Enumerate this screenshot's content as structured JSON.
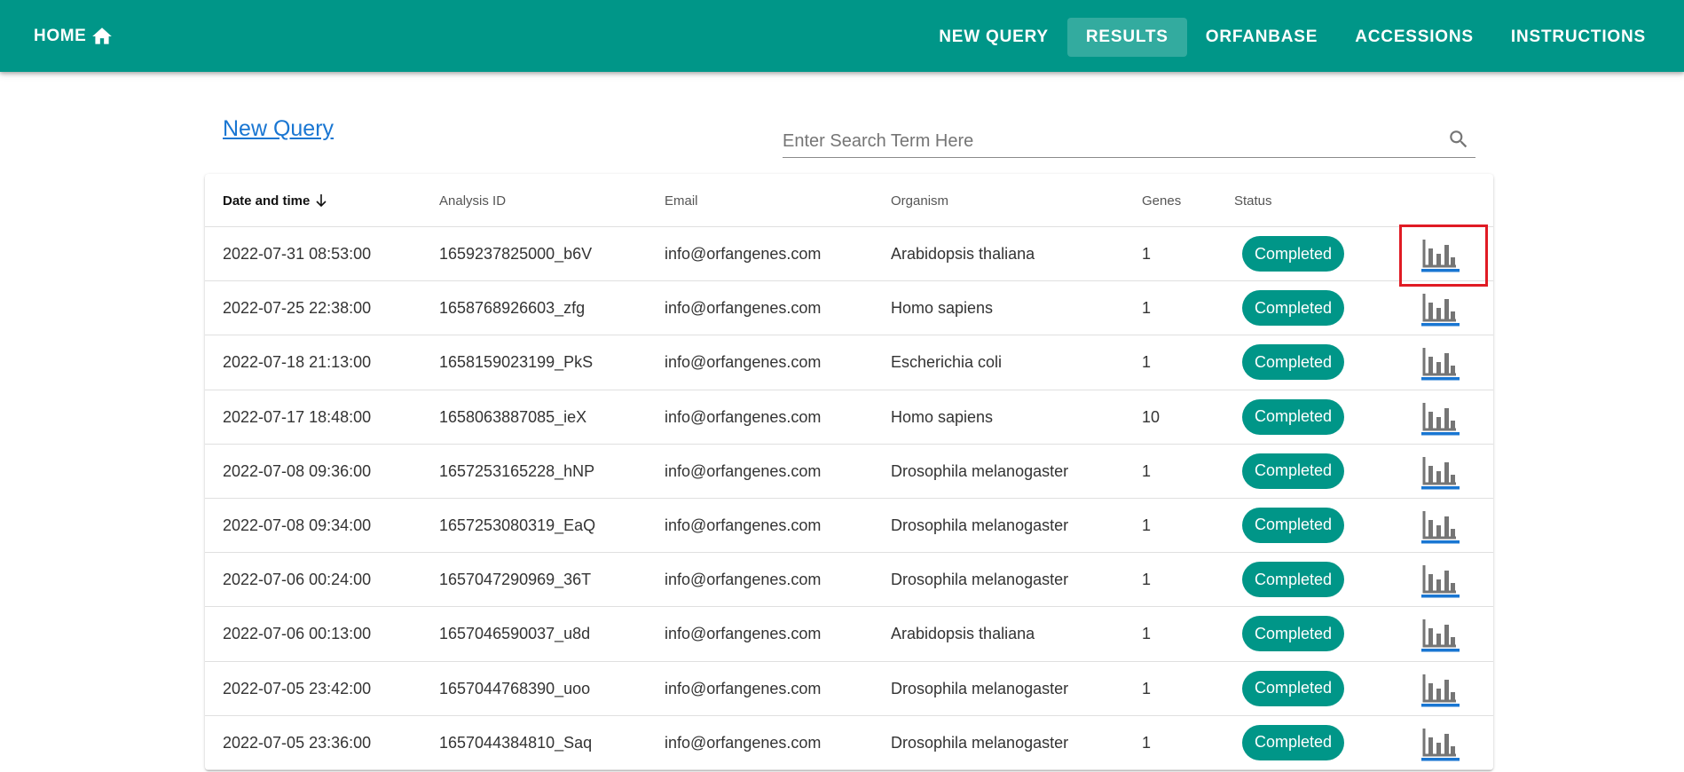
{
  "header": {
    "home_label": "HOME",
    "nav": [
      {
        "label": "NEW QUERY",
        "active": false
      },
      {
        "label": "RESULTS",
        "active": true
      },
      {
        "label": "ORFANBASE",
        "active": false
      },
      {
        "label": "ACCESSIONS",
        "active": false
      },
      {
        "label": "INSTRUCTIONS",
        "active": false
      }
    ]
  },
  "new_query_link": "New Query",
  "search": {
    "placeholder": "Enter Search Term Here",
    "value": ""
  },
  "table": {
    "columns": {
      "date": "Date and time",
      "analysis_id": "Analysis ID",
      "email": "Email",
      "organism": "Organism",
      "genes": "Genes",
      "status": "Status"
    },
    "sorted_by": "date",
    "sort_direction": "descending",
    "rows": [
      {
        "date": "2022-07-31 08:53:00",
        "analysis_id": "1659237825000_b6V",
        "email": "info@orfangenes.com",
        "organism": "Arabidopsis thaliana",
        "genes": "1",
        "status": "Completed",
        "highlighted": true
      },
      {
        "date": "2022-07-25 22:38:00",
        "analysis_id": "1658768926603_zfg",
        "email": "info@orfangenes.com",
        "organism": "Homo sapiens",
        "genes": "1",
        "status": "Completed"
      },
      {
        "date": "2022-07-18 21:13:00",
        "analysis_id": "1658159023199_PkS",
        "email": "info@orfangenes.com",
        "organism": "Escherichia coli",
        "genes": "1",
        "status": "Completed"
      },
      {
        "date": "2022-07-17 18:48:00",
        "analysis_id": "1658063887085_ieX",
        "email": "info@orfangenes.com",
        "organism": "Homo sapiens",
        "genes": "10",
        "status": "Completed"
      },
      {
        "date": "2022-07-08 09:36:00",
        "analysis_id": "1657253165228_hNP",
        "email": "info@orfangenes.com",
        "organism": "Drosophila melanogaster",
        "genes": "1",
        "status": "Completed"
      },
      {
        "date": "2022-07-08 09:34:00",
        "analysis_id": "1657253080319_EaQ",
        "email": "info@orfangenes.com",
        "organism": "Drosophila melanogaster",
        "genes": "1",
        "status": "Completed"
      },
      {
        "date": "2022-07-06 00:24:00",
        "analysis_id": "1657047290969_36T",
        "email": "info@orfangenes.com",
        "organism": "Drosophila melanogaster",
        "genes": "1",
        "status": "Completed"
      },
      {
        "date": "2022-07-06 00:13:00",
        "analysis_id": "1657046590037_u8d",
        "email": "info@orfangenes.com",
        "organism": "Arabidopsis thaliana",
        "genes": "1",
        "status": "Completed"
      },
      {
        "date": "2022-07-05 23:42:00",
        "analysis_id": "1657044768390_uoo",
        "email": "info@orfangenes.com",
        "organism": "Drosophila melanogaster",
        "genes": "1",
        "status": "Completed"
      },
      {
        "date": "2022-07-05 23:36:00",
        "analysis_id": "1657044384810_Saq",
        "email": "info@orfangenes.com",
        "organism": "Drosophila melanogaster",
        "genes": "1",
        "status": "Completed"
      }
    ]
  },
  "icons": {
    "home": "home-icon",
    "search": "search-icon",
    "sort": "arrow-down-icon",
    "results_chart": "bar-chart-icon"
  },
  "colors": {
    "primary": "#009688",
    "link": "#1976d2",
    "chart_icon_gray": "#757575",
    "chart_icon_underline": "#1976d2",
    "highlight": "#e01b24"
  }
}
